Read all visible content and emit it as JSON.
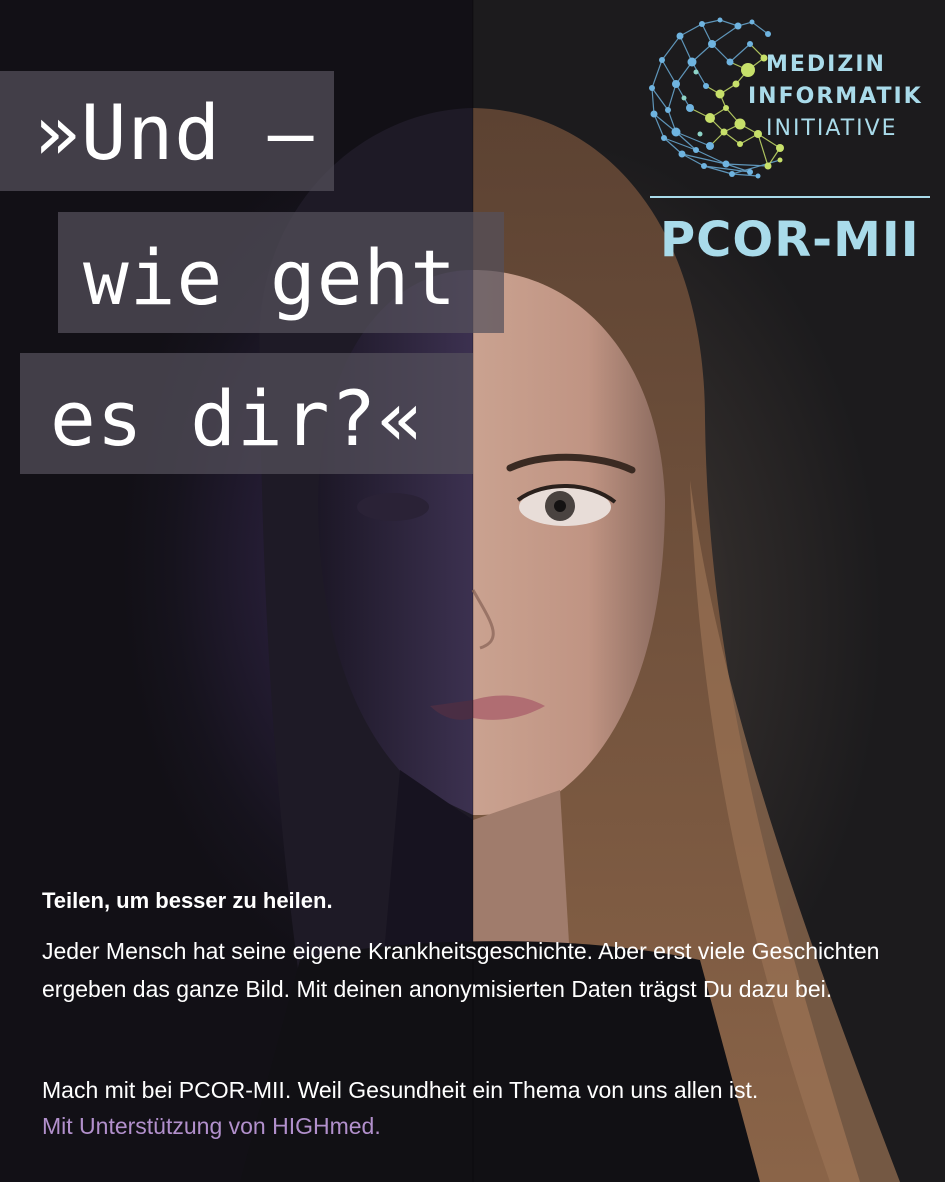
{
  "headline": {
    "line1": "»Und –",
    "line2": "wie geht",
    "line3": "es dir?«"
  },
  "logo": {
    "word1": "MEDIZIN",
    "word2": "INFORMATIK",
    "word3": "INITIATIVE",
    "project": "PCOR-MII",
    "colors": {
      "blue": "#6fb4e0",
      "green": "#c7e06a",
      "teal": "#8ed4c8",
      "text": "#a9dbea"
    }
  },
  "body": {
    "tagline": "Teilen, um besser zu heilen.",
    "paragraph1": "Jeder Mensch hat seine eigene Krankheitsgeschichte. Aber erst viele Geschichten ergeben das ganze Bild. Mit deinen anonymisierten Daten trägst Du dazu bei.",
    "paragraph2": "Mach mit bei PCOR-MII. Weil Gesundheit ein Thema von uns allen ist.",
    "support": "Mit Unterstützung von HIGHmed."
  },
  "colors": {
    "accent_purple": "#b290cc",
    "headline_box": "#55505c",
    "background": "#151419"
  }
}
